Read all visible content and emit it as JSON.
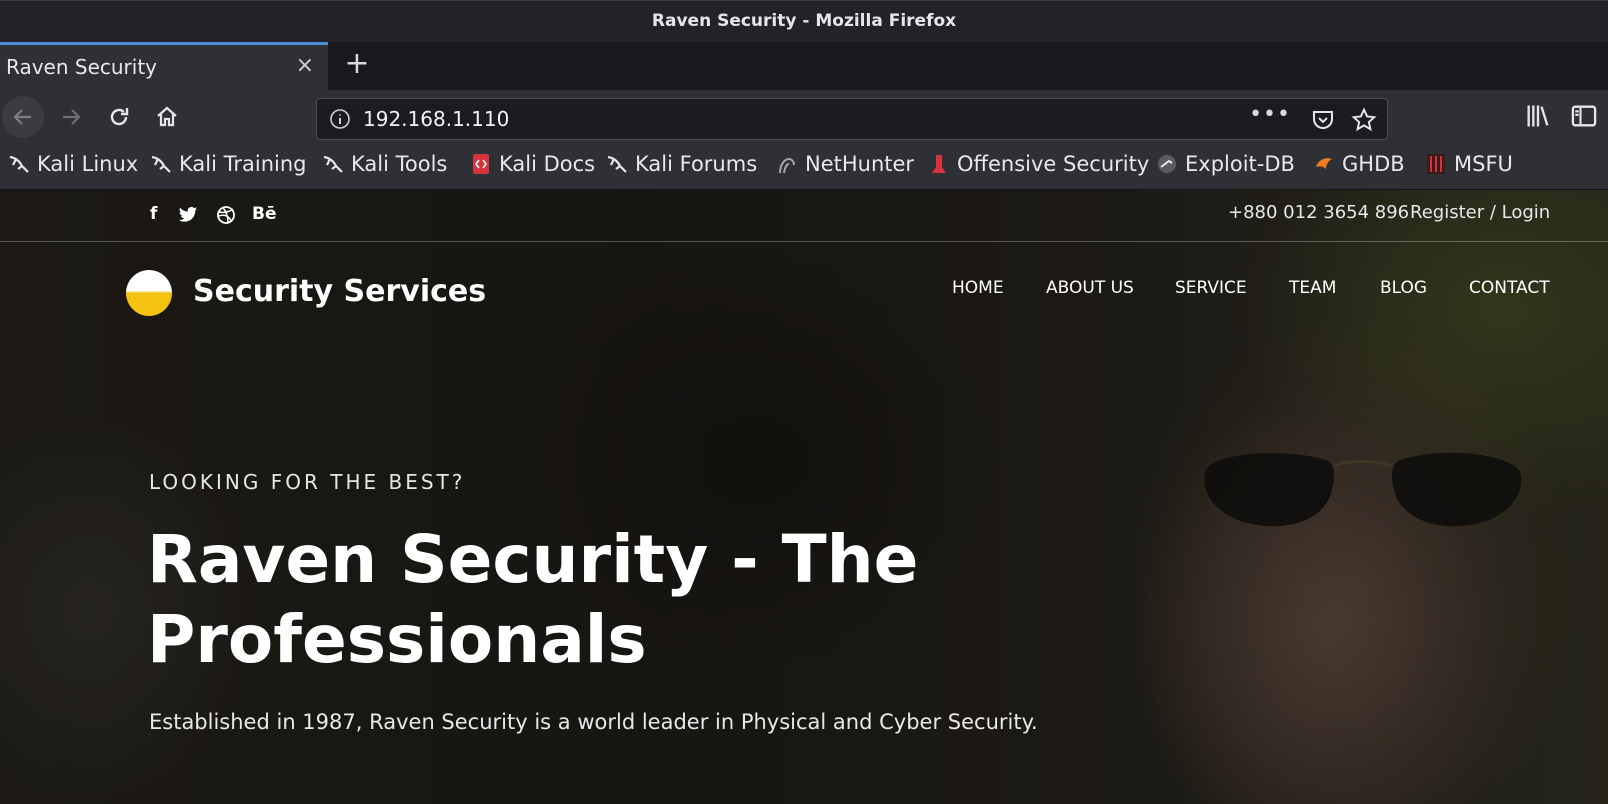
{
  "window": {
    "title": "Raven Security - Mozilla Firefox"
  },
  "tab": {
    "label": "Raven Security",
    "close": "×",
    "new_tab": "+"
  },
  "navbar": {
    "url": "192.168.1.110",
    "more": "•••"
  },
  "bookmarks": [
    {
      "label": "Kali Linux",
      "icon": "kali-dragon-icon"
    },
    {
      "label": "Kali Training",
      "icon": "kali-dragon-icon"
    },
    {
      "label": "Kali Tools",
      "icon": "kali-dragon-icon"
    },
    {
      "label": "Kali Docs",
      "icon": "kali-docs-icon"
    },
    {
      "label": "Kali Forums",
      "icon": "kali-dragon-icon"
    },
    {
      "label": "NetHunter",
      "icon": "nethunter-icon"
    },
    {
      "label": "Offensive Security",
      "icon": "offsec-icon"
    },
    {
      "label": "Exploit-DB",
      "icon": "exploitdb-icon"
    },
    {
      "label": "GHDB",
      "icon": "ghdb-icon"
    },
    {
      "label": "MSFU",
      "icon": "msfu-icon"
    }
  ],
  "site": {
    "social": {
      "facebook": "f",
      "behance": "Bē"
    },
    "phone": "+880 012 3654 896",
    "register": "Register / Login",
    "brand": "Security Services",
    "menu": [
      "HOME",
      "ABOUT US",
      "SERVICE",
      "TEAM",
      "BLOG",
      "CONTACT"
    ],
    "hero": {
      "eyebrow": "LOOKING FOR THE BEST?",
      "headline": "Raven Security - The Professionals",
      "tagline": "Established in 1987, Raven Security is a world leader in Physical and Cyber Security."
    }
  },
  "colors": {
    "accent_tab": "#4a90d9",
    "logo_yellow": "#f4c30f"
  }
}
